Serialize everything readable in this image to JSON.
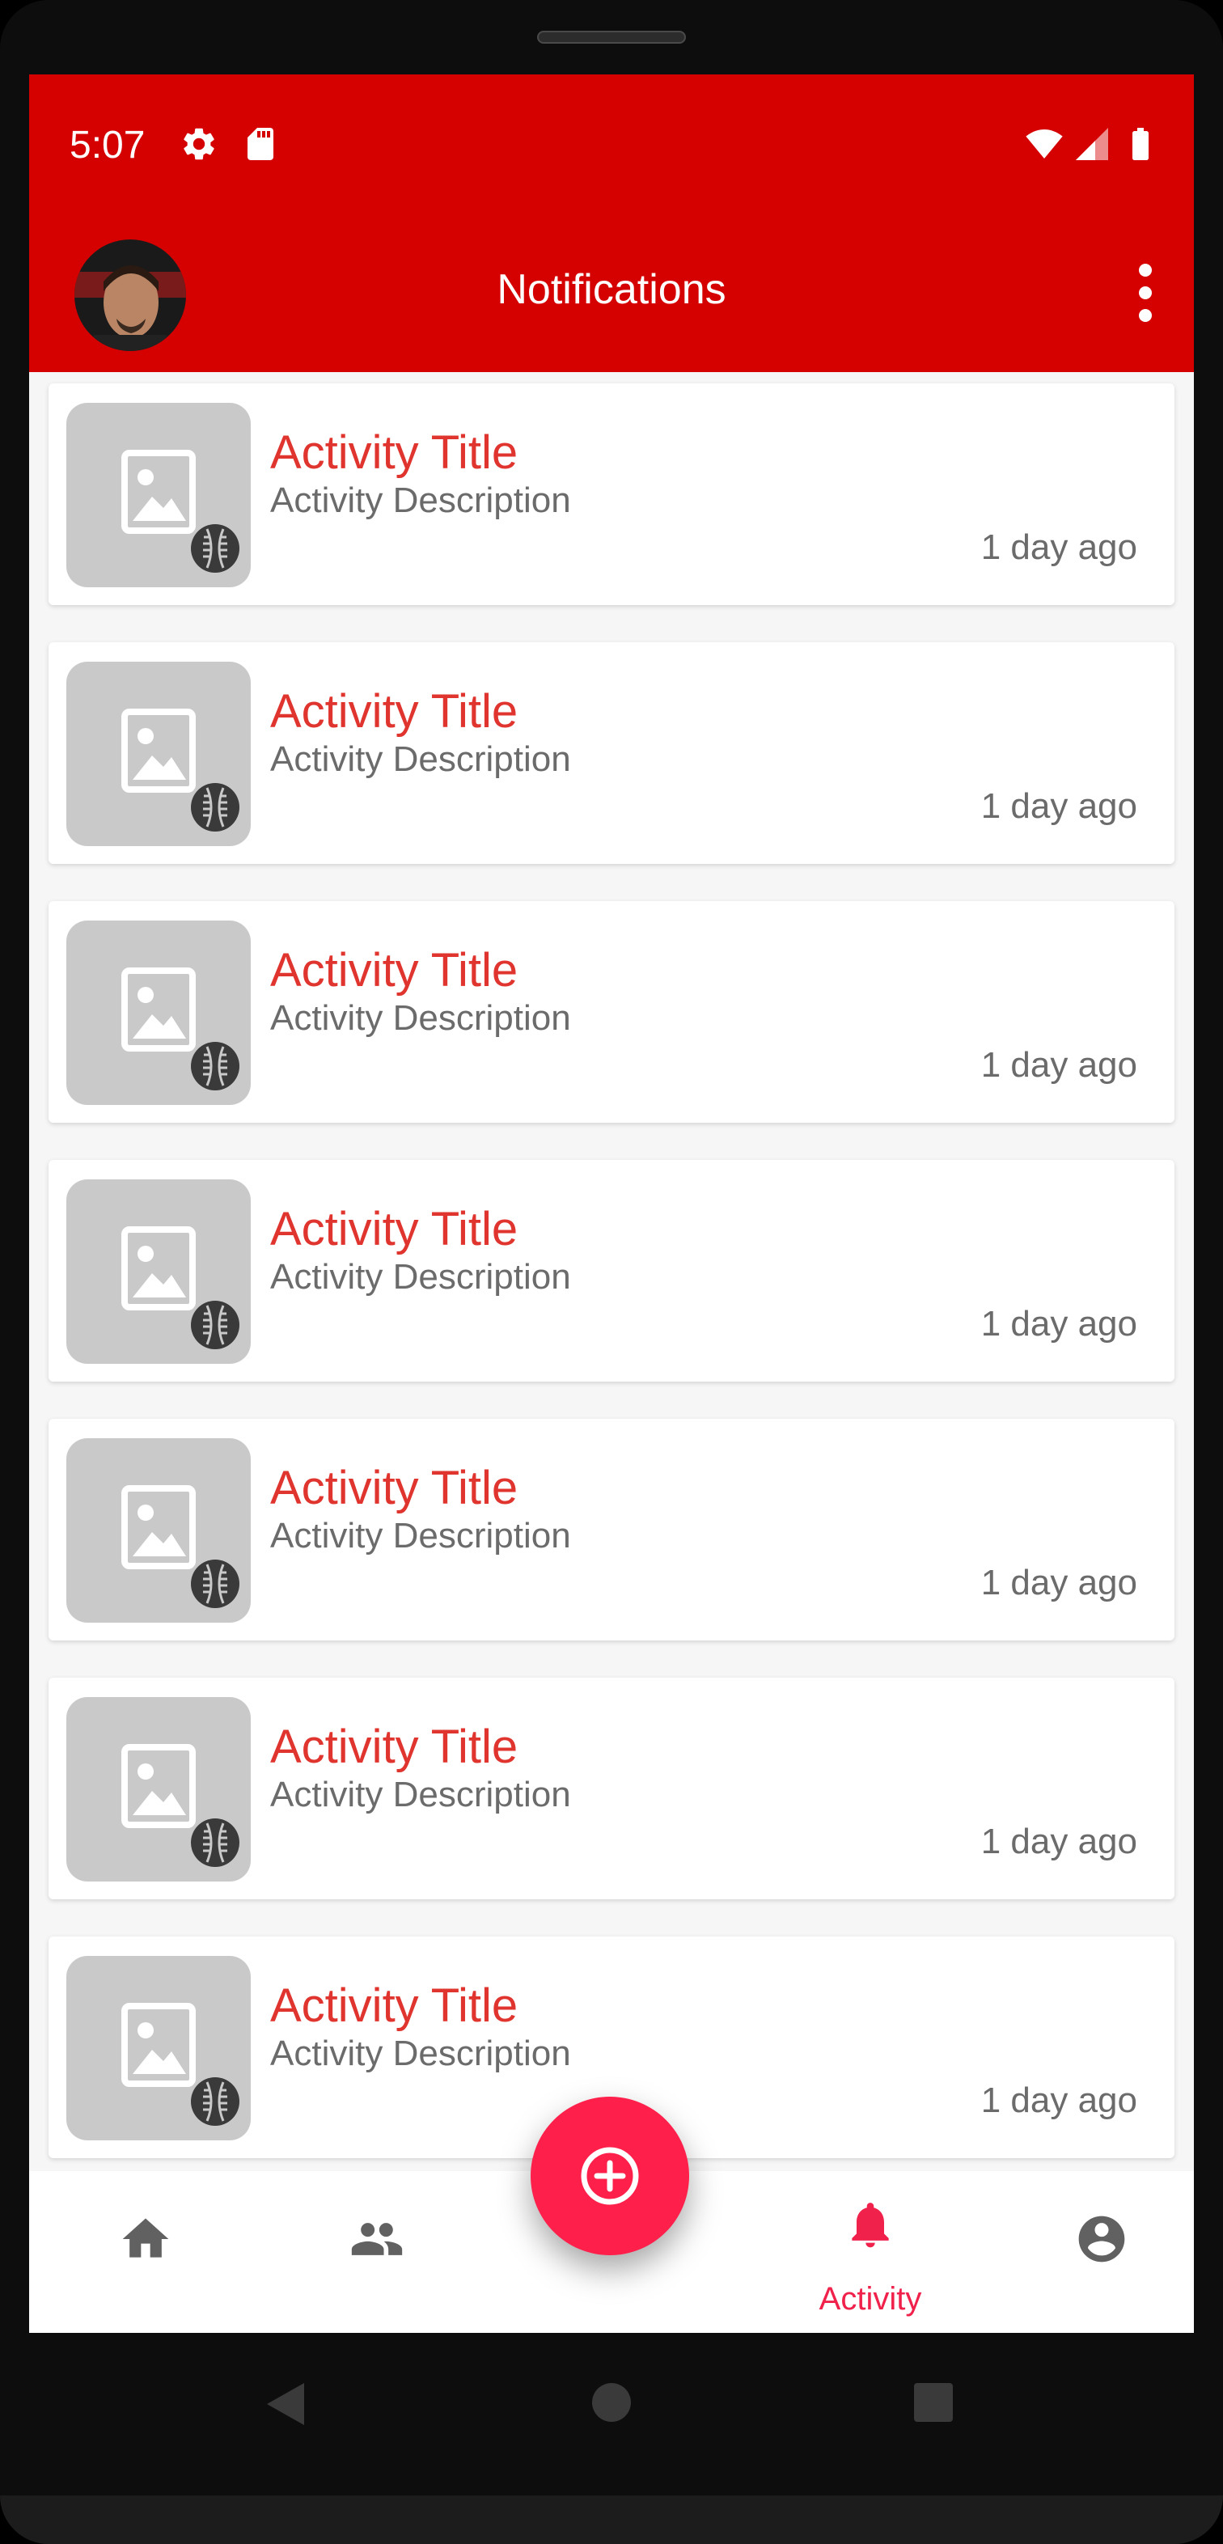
{
  "status_bar": {
    "time": "5:07"
  },
  "app_bar": {
    "title": "Notifications"
  },
  "activities": [
    {
      "title": "Activity Title",
      "description": "Activity Description",
      "time": "1 day ago"
    },
    {
      "title": "Activity Title",
      "description": "Activity Description",
      "time": "1 day ago"
    },
    {
      "title": "Activity Title",
      "description": "Activity Description",
      "time": "1 day ago"
    },
    {
      "title": "Activity Title",
      "description": "Activity Description",
      "time": "1 day ago"
    },
    {
      "title": "Activity Title",
      "description": "Activity Description",
      "time": "1 day ago"
    },
    {
      "title": "Activity Title",
      "description": "Activity Description",
      "time": "1 day ago"
    },
    {
      "title": "Activity Title",
      "description": "Activity Description",
      "time": "1 day ago"
    }
  ],
  "bottom_nav": {
    "items": [
      {
        "icon": "home-icon",
        "label": ""
      },
      {
        "icon": "people-icon",
        "label": ""
      },
      {
        "icon": "bell-icon",
        "label": "Activity"
      },
      {
        "icon": "account-circle-icon",
        "label": ""
      }
    ],
    "active": "Activity"
  },
  "fab": {
    "icon": "add-circle-icon"
  },
  "colors": {
    "primary": "#d50000",
    "accent": "#ff1f4b",
    "title_text": "#e0342e",
    "secondary_text": "#6b6b6b"
  }
}
